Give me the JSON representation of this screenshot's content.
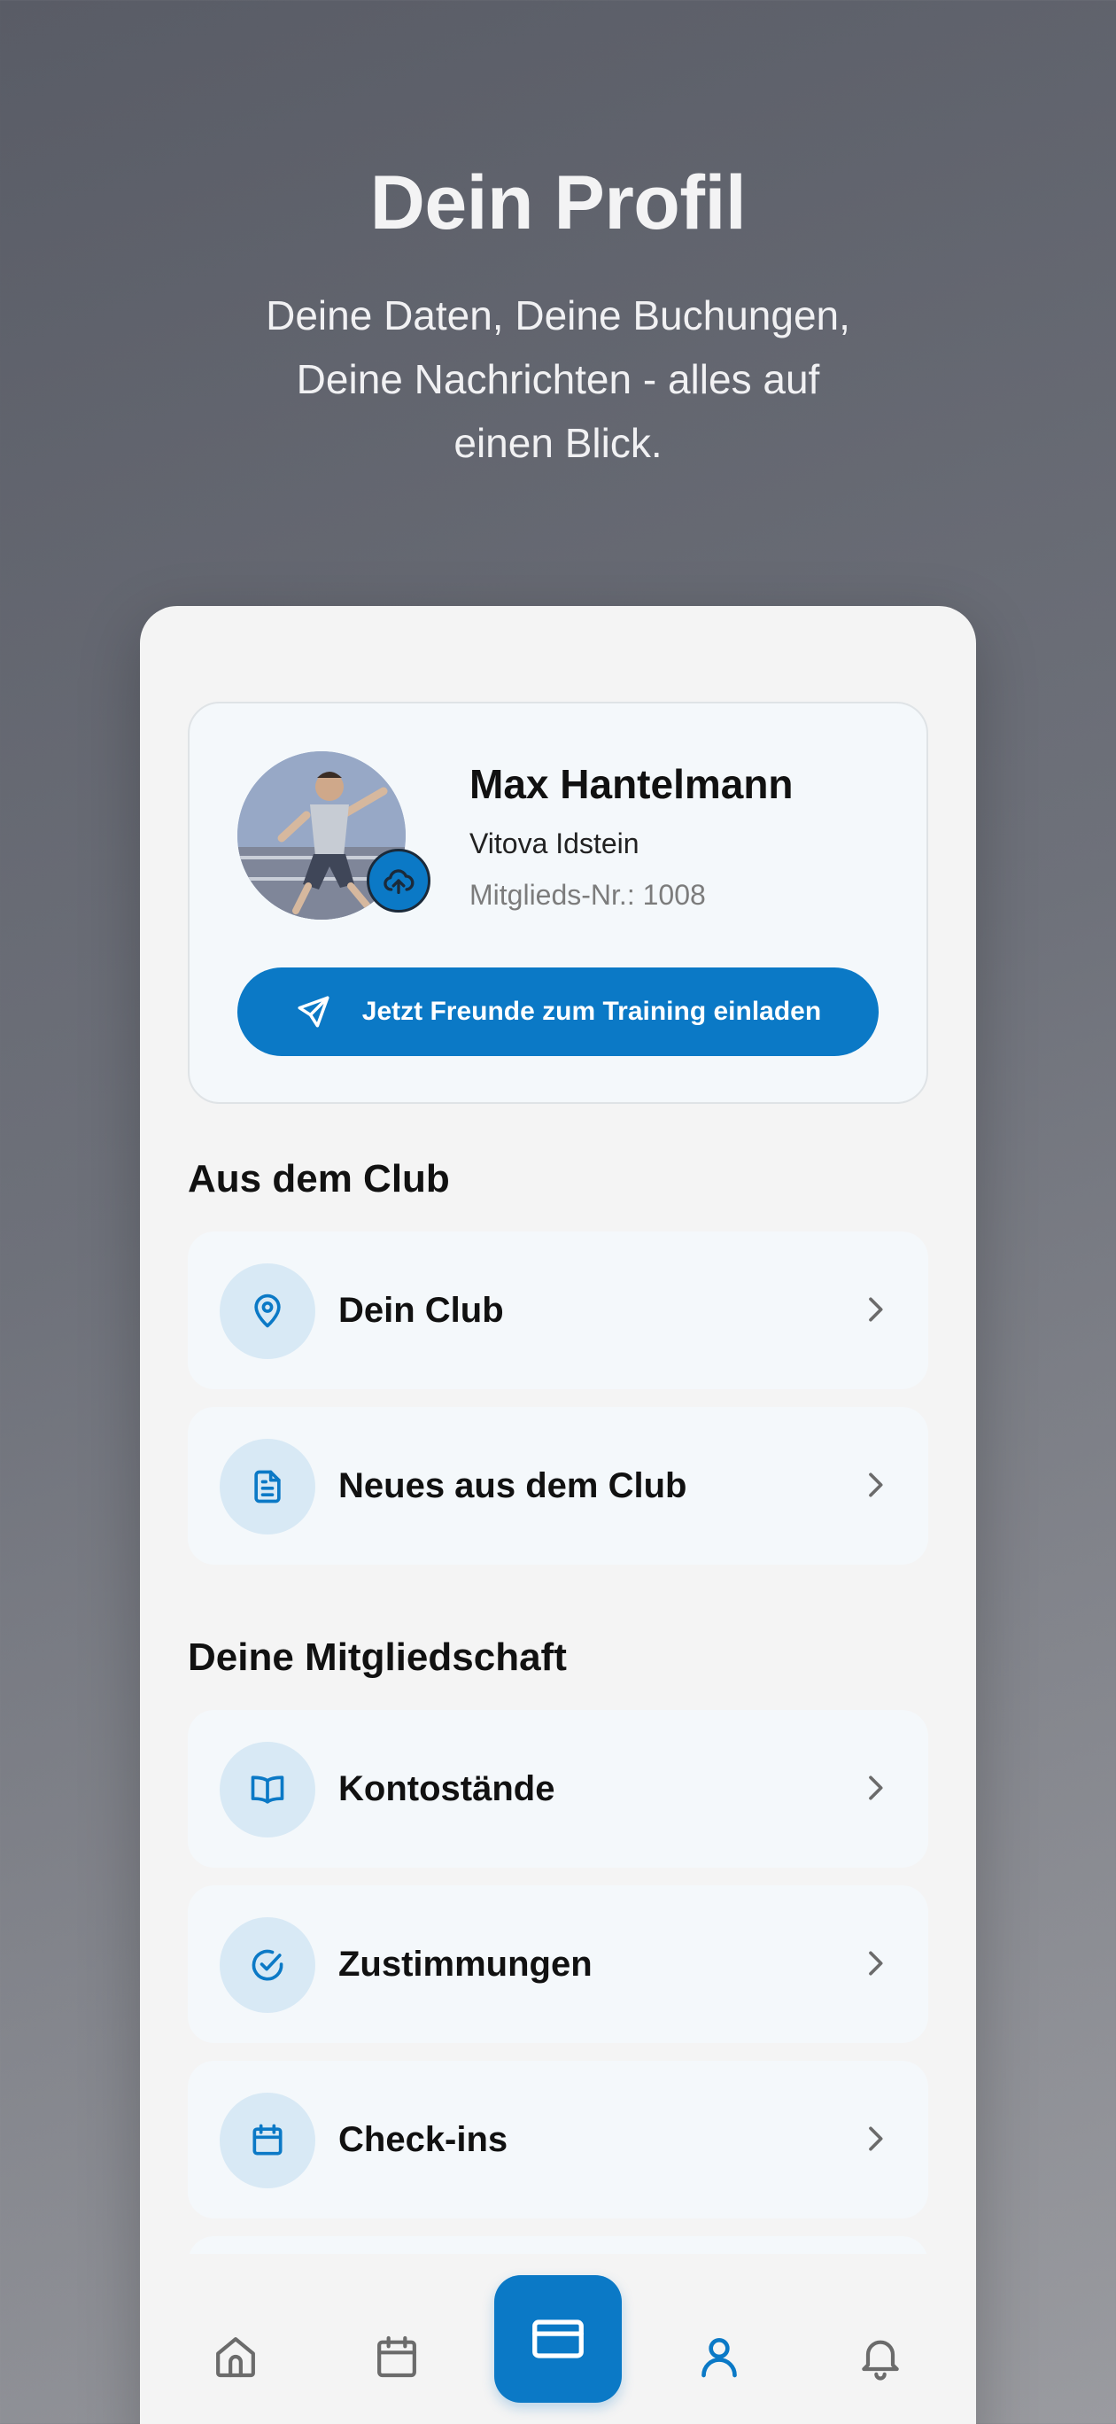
{
  "hero": {
    "title": "Dein Profil",
    "subtitle_line1": "Deine Daten, Deine Buchungen,",
    "subtitle_line2": "Deine Nachrichten - alles auf",
    "subtitle_line3": "einen Blick."
  },
  "profile": {
    "name": "Max Hantelmann",
    "club": "Vitova Idstein",
    "member_number": "Mitglieds-Nr.: 1008",
    "invite_button": "Jetzt Freunde zum Training einladen"
  },
  "sections": {
    "club_title": "Aus dem Club",
    "membership_title": "Deine Mitgliedschaft"
  },
  "club_items": [
    {
      "label": "Dein Club",
      "icon": "map-pin-icon"
    },
    {
      "label": "Neues aus dem Club",
      "icon": "document-icon"
    }
  ],
  "membership_items": [
    {
      "label": "Kontostände",
      "icon": "book-icon"
    },
    {
      "label": "Zustimmungen",
      "icon": "check-circle-icon"
    },
    {
      "label": "Check-ins",
      "icon": "calendar-icon"
    }
  ],
  "bottom_nav": [
    {
      "name": "home",
      "icon": "home-icon"
    },
    {
      "name": "calendar",
      "icon": "calendar-icon"
    },
    {
      "name": "card",
      "icon": "card-icon"
    },
    {
      "name": "profile",
      "icon": "user-icon",
      "active": true
    },
    {
      "name": "notifications",
      "icon": "bell-icon"
    }
  ],
  "colors": {
    "accent": "#0b79c6",
    "icon_bg": "#d8e9f5",
    "card_bg": "#f4f8fb",
    "nav_inactive": "#6b6b6b"
  }
}
